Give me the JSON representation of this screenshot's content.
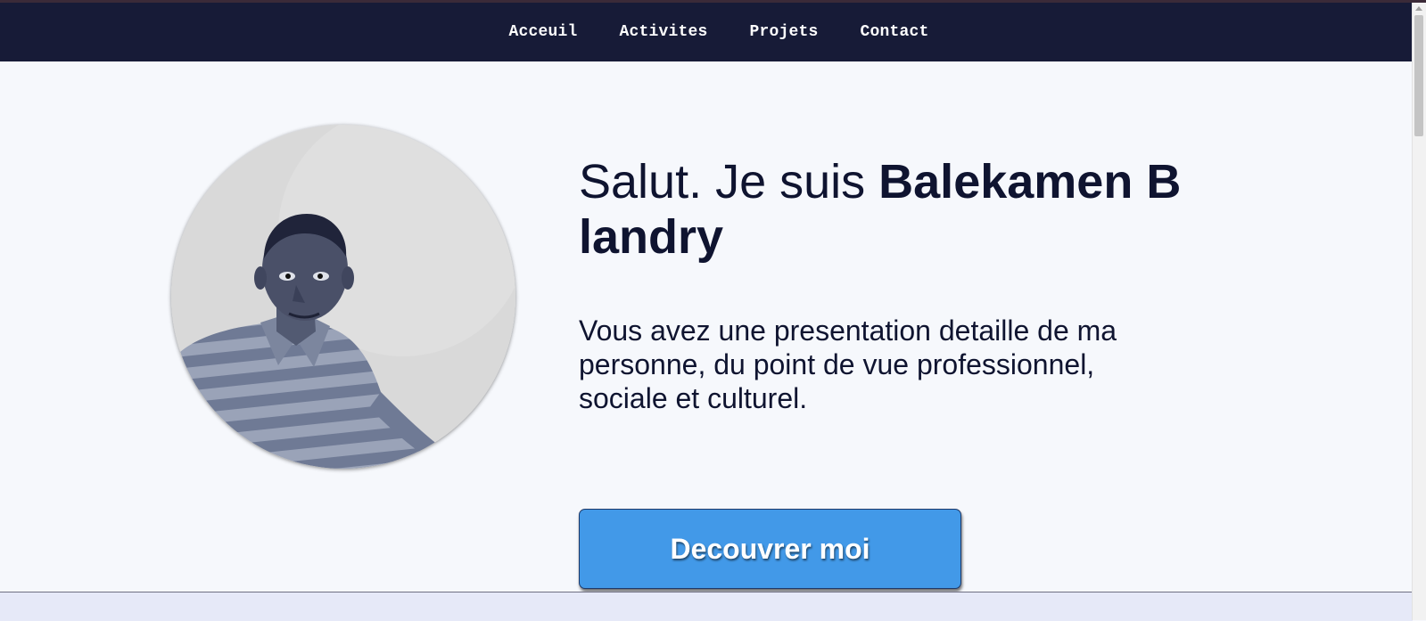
{
  "nav": {
    "items": [
      {
        "label": "Acceuil"
      },
      {
        "label": "Activites"
      },
      {
        "label": "Projets"
      },
      {
        "label": "Contact"
      }
    ]
  },
  "hero": {
    "greeting": "Salut. Je suis ",
    "name": "Balekamen B landry",
    "intro": "Vous avez une presentation detaille de ma personne, du point de vue professionnel, sociale et culturel.",
    "cta_label": "Decouvrer moi"
  },
  "colors": {
    "nav_background": "#171b37",
    "page_background": "#f6f8fc",
    "button_background": "#4299e8",
    "text_dark": "#0f1430",
    "next_section_background": "#e6e9f8"
  }
}
